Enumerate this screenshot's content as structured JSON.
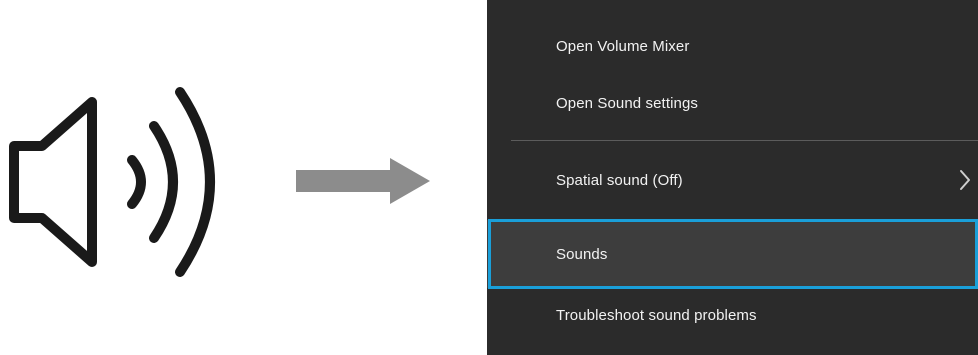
{
  "menu": {
    "items": [
      {
        "label": "Open Volume Mixer"
      },
      {
        "label": "Open Sound settings"
      },
      {
        "label": "Spatial sound (Off)"
      },
      {
        "label": "Sounds"
      },
      {
        "label": "Troubleshoot sound problems"
      }
    ]
  },
  "icons": {
    "speaker": "speaker-volume-icon",
    "arrow": "right-arrow-icon",
    "submenu": "chevron-right-icon"
  },
  "colors": {
    "menu_background": "#2b2b2b",
    "menu_text": "#f2f2f2",
    "hover_background": "#3d3d3d",
    "highlight_border": "#1a9fd9",
    "arrow": "#8c8c8c"
  }
}
